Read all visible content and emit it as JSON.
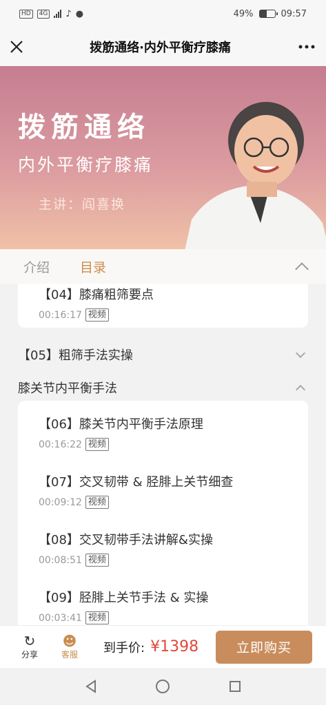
{
  "status": {
    "network": "HD",
    "signal_type": "4G",
    "battery": "49%",
    "battery_level": 0.49,
    "time": "09:57"
  },
  "titlebar": {
    "close_icon": "close-icon",
    "title": "拨筋通络·内外平衡疗膝痛",
    "more_icon": "more-icon"
  },
  "banner": {
    "title": "拨筋通络",
    "subtitle": "内外平衡疗膝痛",
    "speaker": "主讲：阎喜换"
  },
  "tabs": [
    {
      "label": "介绍"
    },
    {
      "label": "目录"
    }
  ],
  "catalog": {
    "item_04": {
      "title": "【04】膝痛粗筛要点",
      "duration": "00:16:17",
      "type": "视频"
    },
    "section_05": {
      "title": "【05】粗筛手法实操"
    },
    "section_knee": {
      "title": "膝关节内平衡手法"
    },
    "items": [
      {
        "title": "【06】膝关节内平衡手法原理",
        "duration": "00:16:22",
        "type": "视频"
      },
      {
        "title": "【07】交叉韧带 & 胫腓上关节细查",
        "duration": "00:09:12",
        "type": "视频"
      },
      {
        "title": "【08】交叉韧带手法讲解&实操",
        "duration": "00:08:51",
        "type": "视频"
      },
      {
        "title": "【09】胫腓上关节手法 & 实操",
        "duration": "00:03:41",
        "type": "视频"
      }
    ]
  },
  "bottom": {
    "share_label": "分享",
    "service_label": "客服",
    "price_label": "到手价:",
    "price": "¥1398",
    "buy_label": "立即购买",
    "accent_color": "#c98d5d",
    "price_color": "#e0483a"
  }
}
